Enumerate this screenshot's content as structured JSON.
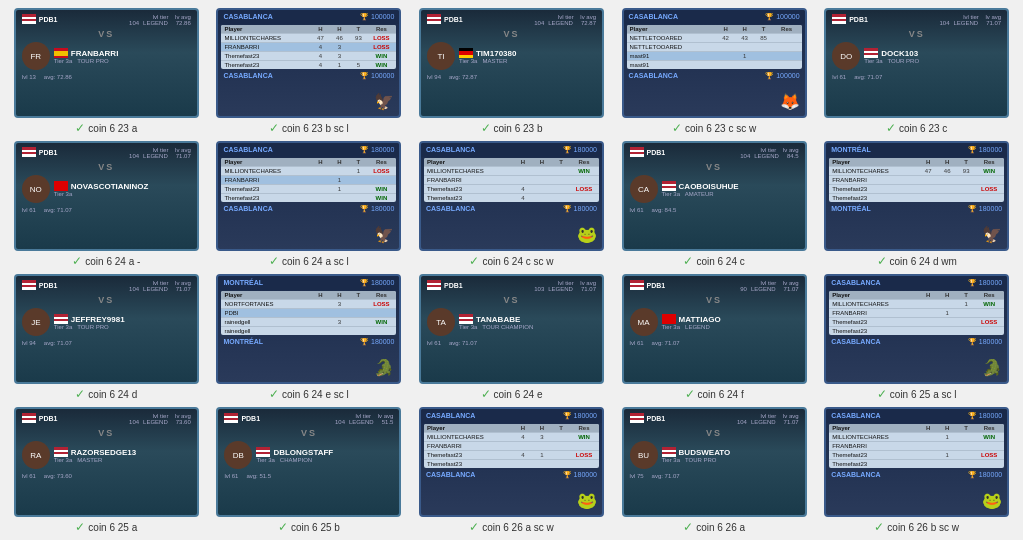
{
  "cards": [
    {
      "id": "c1",
      "type": "vs",
      "label": "coin 6 23 a",
      "player1": "PDB1",
      "player2": "FRANBARRI",
      "flag1": "us",
      "flag2": "es",
      "tier1": "LEGEND",
      "tier2": "3a",
      "tier2name": "TOUR PRO",
      "avg": "72.86",
      "lvl1": "104",
      "lvl2": "13",
      "selected": false
    },
    {
      "id": "c2",
      "type": "scoreboard",
      "label": "coin 6 23 b sc l",
      "location": "CASABLANCA",
      "prize": "100000",
      "players": [
        {
          "name": "MILLIONTECHARES",
          "s1": "47",
          "s2": "46",
          "s3": "93",
          "result": "LOSS",
          "hl": false
        },
        {
          "name": "FRANBARRI",
          "s1": "4",
          "s2": "3",
          "s3": "",
          "result": "LOSS",
          "hl": true
        },
        {
          "name": "Themefast23",
          "s1": "4",
          "s2": "3",
          "s3": "",
          "result": "WIN",
          "hl": false
        },
        {
          "name": "Themefast23",
          "s1": "4",
          "s2": "1",
          "s3": "5",
          "result": "WIN",
          "hl": false
        }
      ],
      "mascot": "🦅",
      "selected": false
    },
    {
      "id": "c3",
      "type": "vs",
      "label": "coin 6 23 b",
      "player1": "PDB1",
      "player2": "TIM170380",
      "flag1": "us",
      "flag2": "de",
      "tier1": "LEGEND",
      "tier2": "3a",
      "tier2name": "MASTER",
      "avg": "72.87",
      "lvl1": "104",
      "lvl2": "94",
      "selected": false
    },
    {
      "id": "c4",
      "type": "scoreboard",
      "label": "coin 6 23 c sc w",
      "location": "CASABLANCA",
      "prize": "100000",
      "players": [
        {
          "name": "NETTLETOOARED",
          "s1": "42",
          "s2": "43",
          "s3": "85",
          "result": "",
          "hl": false
        },
        {
          "name": "NETTLETOOARED",
          "s1": "",
          "s2": "",
          "s3": "",
          "result": "",
          "hl": false
        },
        {
          "name": "mast91",
          "s1": "",
          "s2": "1",
          "s3": "",
          "result": "",
          "hl": true
        },
        {
          "name": "mast91",
          "s1": "",
          "s2": "",
          "s3": "",
          "result": "",
          "hl": false
        }
      ],
      "mascot": "🦊",
      "selected": false
    },
    {
      "id": "c5",
      "type": "vs",
      "label": "coin 6 23 c",
      "player1": "PDB1",
      "player2": "DOCK103",
      "flag1": "us",
      "flag2": "us",
      "tier1": "LEGEND",
      "tier2": "3a",
      "tier2name": "TOUR PRO",
      "avg": "71.07",
      "lvl1": "104",
      "lvl2": "61",
      "selected": false
    },
    {
      "id": "c6",
      "type": "vs",
      "label": "coin 6 24 a -",
      "player1": "PDB1",
      "player2": "NOVASCOTIANINOZ",
      "flag1": "us",
      "flag2": "ca",
      "tier1": "LEGEND",
      "tier2": "3a",
      "tier2name": "",
      "avg": "71.07",
      "lvl1": "104",
      "lvl2": "61",
      "selected": false
    },
    {
      "id": "c7",
      "type": "scoreboard",
      "label": "coin 6 24 a sc l",
      "location": "CASABLANCA",
      "prize": "180000",
      "players": [
        {
          "name": "MILLIONTECHARES",
          "s1": "",
          "s2": "",
          "s3": "1",
          "result": "LOSS",
          "hl": false
        },
        {
          "name": "FRANBARRI",
          "s1": "",
          "s2": "1",
          "s3": "",
          "result": "",
          "hl": true
        },
        {
          "name": "Themefast23",
          "s1": "",
          "s2": "1",
          "s3": "",
          "result": "WIN",
          "hl": false
        },
        {
          "name": "Themefast23",
          "s1": "",
          "s2": "",
          "s3": "",
          "result": "WIN",
          "hl": false
        }
      ],
      "mascot": "🦅",
      "selected": false
    },
    {
      "id": "c8",
      "type": "scoreboard",
      "label": "coin 6 24 c sc w",
      "location": "CASABLANCA",
      "prize": "180000",
      "players": [
        {
          "name": "MILLIONTECHARES",
          "s1": "",
          "s2": "",
          "s3": "",
          "result": "WIN",
          "hl": false
        },
        {
          "name": "FRANBARRI",
          "s1": "",
          "s2": "",
          "s3": "",
          "result": "",
          "hl": false
        },
        {
          "name": "Themefast23",
          "s1": "4",
          "s2": "",
          "s3": "",
          "result": "LOSS",
          "hl": false
        },
        {
          "name": "Themefast23",
          "s1": "4",
          "s2": "",
          "s3": "",
          "result": "",
          "hl": false
        }
      ],
      "mascot": "🐸",
      "selected": false
    },
    {
      "id": "c9",
      "type": "vs",
      "label": "coin 6 24 c",
      "player1": "PDB1",
      "player2": "CAOBOISUHUE",
      "flag1": "us",
      "flag2": "us",
      "tier1": "LEGEND",
      "tier2": "3a",
      "tier2name": "AMATEUR",
      "avg": "84.5",
      "lvl1": "104",
      "lvl2": "61",
      "selected": false
    },
    {
      "id": "c10",
      "type": "scoreboard",
      "label": "coin 6 24 d wm",
      "location": "MONTRÉAL",
      "prize": "180000",
      "players": [
        {
          "name": "MILLIONTECHARES",
          "s1": "47",
          "s2": "46",
          "s3": "93",
          "result": "WIN",
          "hl": false
        },
        {
          "name": "FRANBARRI",
          "s1": "",
          "s2": "",
          "s3": "",
          "result": "",
          "hl": false
        },
        {
          "name": "Themefast23",
          "s1": "",
          "s2": "",
          "s3": "",
          "result": "LOSS",
          "hl": false
        },
        {
          "name": "Themefast23",
          "s1": "",
          "s2": "",
          "s3": "",
          "result": "",
          "hl": false
        }
      ],
      "mascot": "🦅",
      "selected": false
    },
    {
      "id": "c11",
      "type": "vs",
      "label": "coin 6 24 d",
      "player1": "PDB1",
      "player2": "JEFFREY9981",
      "flag1": "us",
      "flag2": "us",
      "tier1": "LEGEND",
      "tier2": "3a",
      "tier2name": "TOUR PRO",
      "avg": "71.07",
      "lvl1": "104",
      "lvl2": "94",
      "selected": false
    },
    {
      "id": "c12",
      "type": "scoreboard",
      "label": "coin 6 24 e sc l",
      "location": "MONTRÉAL",
      "prize": "180000",
      "players": [
        {
          "name": "NORTFORTANES",
          "s1": "",
          "s2": "3",
          "s3": "",
          "result": "LOSS",
          "hl": false
        },
        {
          "name": "PDBI",
          "s1": "",
          "s2": "",
          "s3": "",
          "result": "",
          "hl": true
        },
        {
          "name": "rainedgell",
          "s1": "",
          "s2": "3",
          "s3": "",
          "result": "WIN",
          "hl": false
        },
        {
          "name": "rainedgell",
          "s1": "",
          "s2": "",
          "s3": "",
          "result": "",
          "hl": false
        }
      ],
      "mascot": "🐊",
      "selected": false
    },
    {
      "id": "c13",
      "type": "vs",
      "label": "coin 6 24 e",
      "player1": "PDB1",
      "player2": "TANABABE",
      "flag1": "us",
      "flag2": "us",
      "tier1": "LEGEND",
      "tier2": "3a",
      "tier2name": "TOUR CHAMPION",
      "avg": "71.07",
      "lvl1": "103",
      "lvl2": "61",
      "selected": false
    },
    {
      "id": "c14",
      "type": "vs",
      "label": "coin 6 24 f",
      "player1": "PDB1",
      "player2": "MATTIAGO",
      "flag1": "us",
      "flag2": "ca",
      "tier1": "LEGEND",
      "tier2": "3a",
      "tier2name": "LEGEND",
      "avg": "71.07",
      "lvl1": "90",
      "lvl2": "61",
      "selected": false
    },
    {
      "id": "c15",
      "type": "scoreboard",
      "label": "coin 6 25 a sc l",
      "location": "CASABLANCA",
      "prize": "180000",
      "players": [
        {
          "name": "MILLIONTECHARES",
          "s1": "",
          "s2": "",
          "s3": "1",
          "result": "WIN",
          "hl": false
        },
        {
          "name": "FRANBARRI",
          "s1": "",
          "s2": "1",
          "s3": "",
          "result": "",
          "hl": false
        },
        {
          "name": "Themefast23",
          "s1": "",
          "s2": "",
          "s3": "",
          "result": "LOSS",
          "hl": false
        },
        {
          "name": "Themefast23",
          "s1": "",
          "s2": "",
          "s3": "",
          "result": "",
          "hl": false
        }
      ],
      "mascot": "🐊",
      "selected": false
    },
    {
      "id": "c16",
      "type": "vs",
      "label": "coin 6 25 a",
      "player1": "PDB1",
      "player2": "RAZORSEDGE13",
      "flag1": "us",
      "flag2": "us",
      "tier1": "LEGEND",
      "tier2": "3a",
      "tier2name": "MASTER",
      "avg": "73.60",
      "lvl1": "104",
      "lvl2": "61",
      "selected": false
    },
    {
      "id": "c17",
      "type": "vs",
      "label": "coin 6 25 b",
      "player1": "PDB1",
      "player2": "DBLONGSTAFF",
      "flag1": "us",
      "flag2": "us",
      "tier1": "LEGEND",
      "tier2": "3a",
      "tier2name": "CHAMPION",
      "avg": "51.5",
      "lvl1": "104",
      "lvl2": "61",
      "selected": false
    },
    {
      "id": "c18",
      "type": "scoreboard",
      "label": "coin 6 26 a sc w",
      "location": "CASABLANCA",
      "prize": "180000",
      "players": [
        {
          "name": "MILLIONTECHARES",
          "s1": "4",
          "s2": "3",
          "s3": "",
          "result": "WIN",
          "hl": false
        },
        {
          "name": "FRANBARRI",
          "s1": "",
          "s2": "",
          "s3": "",
          "result": "",
          "hl": false
        },
        {
          "name": "Themefast23",
          "s1": "4",
          "s2": "1",
          "s3": "",
          "result": "LOSS",
          "hl": false
        },
        {
          "name": "Themefast23",
          "s1": "",
          "s2": "",
          "s3": "",
          "result": "",
          "hl": false
        }
      ],
      "mascot": "🐸",
      "selected": false
    },
    {
      "id": "c19",
      "type": "vs",
      "label": "coin 6 26 a",
      "player1": "PDB1",
      "player2": "BUDSWEATO",
      "flag1": "us",
      "flag2": "us",
      "tier1": "LEGEND",
      "tier2": "3a",
      "tier2name": "TOUR PRO",
      "avg": "71.07",
      "lvl1": "104",
      "lvl2": "75",
      "selected": false
    },
    {
      "id": "c20",
      "type": "scoreboard",
      "label": "coin 6 26 b sc w",
      "location": "CASABLANCA",
      "prize": "180000",
      "players": [
        {
          "name": "MILLIONTECHARES",
          "s1": "",
          "s2": "1",
          "s3": "",
          "result": "WIN",
          "hl": false
        },
        {
          "name": "FRANBARRI",
          "s1": "",
          "s2": "",
          "s3": "",
          "result": "",
          "hl": false
        },
        {
          "name": "Themefast23",
          "s1": "",
          "s2": "1",
          "s3": "",
          "result": "LOSS",
          "hl": false
        },
        {
          "name": "Themefast23",
          "s1": "",
          "s2": "",
          "s3": "",
          "result": "",
          "hl": false
        }
      ],
      "mascot": "🐸",
      "selected": false
    }
  ],
  "ui": {
    "check_symbol": "✓"
  }
}
